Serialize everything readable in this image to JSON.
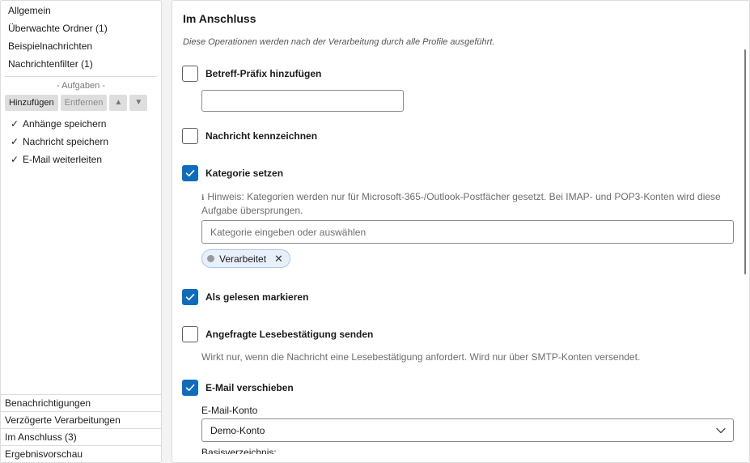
{
  "sidebar": {
    "top_items": [
      {
        "label": "Allgemein"
      },
      {
        "label": "Überwachte Ordner (1)"
      },
      {
        "label": "Beispielnachrichten"
      },
      {
        "label": "Nachrichtenfilter (1)"
      }
    ],
    "tasks_header": "- Aufgaben -",
    "toolbar": {
      "add_label": "Hinzufügen",
      "remove_label": "Entfernen",
      "up_label": "▲",
      "down_label": "▼"
    },
    "tasks": [
      {
        "check": "✓",
        "label": "Anhänge speichern"
      },
      {
        "check": "✓",
        "label": "Nachricht speichern"
      },
      {
        "check": "✓",
        "label": "E-Mail weiterleiten"
      }
    ],
    "bottom_items": [
      {
        "label": "Benachrichtigungen"
      },
      {
        "label": "Verzögerte Verarbeitungen"
      },
      {
        "label": "Im Anschluss (3)"
      },
      {
        "label": "Ergebnisvorschau"
      }
    ]
  },
  "main": {
    "title": "Im Anschluss",
    "subtitle": "Diese Operationen werden nach der Verarbeitung durch alle Profile ausgeführt.",
    "options": {
      "subject_prefix": {
        "label": "Betreff-Präfix hinzufügen",
        "checked": false,
        "value": ""
      },
      "flag_message": {
        "label": "Nachricht kennzeichnen",
        "checked": false
      },
      "set_category": {
        "label": "Kategorie setzen",
        "checked": true,
        "hint_icon": "ℹ",
        "hint": "Hinweis: Kategorien werden nur für Microsoft-365-/Outlook-Postfächer gesetzt. Bei IMAP- und POP3-Konten wird diese Aufgabe übersprungen.",
        "placeholder": "Kategorie eingeben oder auswählen",
        "chip_label": "Verarbeitet",
        "chip_remove": "✕"
      },
      "mark_read": {
        "label": "Als gelesen markieren",
        "checked": true
      },
      "read_receipt": {
        "label": "Angefragte Lesebestätigung senden",
        "checked": false,
        "hint": "Wirkt nur, wenn die Nachricht eine Lesebestätigung anfordert. Wird nur über SMTP-Konten versendet."
      },
      "move_mail": {
        "label": "E-Mail verschieben",
        "checked": true,
        "account_label": "E-Mail-Konto",
        "account_value": "Demo-Konto",
        "next_label": "Basisverzeichnis:"
      }
    },
    "colors": {
      "accent": "#0f6cbd",
      "chip_bg": "#e8f1fb",
      "hint_text": "#6d6d6d"
    }
  }
}
